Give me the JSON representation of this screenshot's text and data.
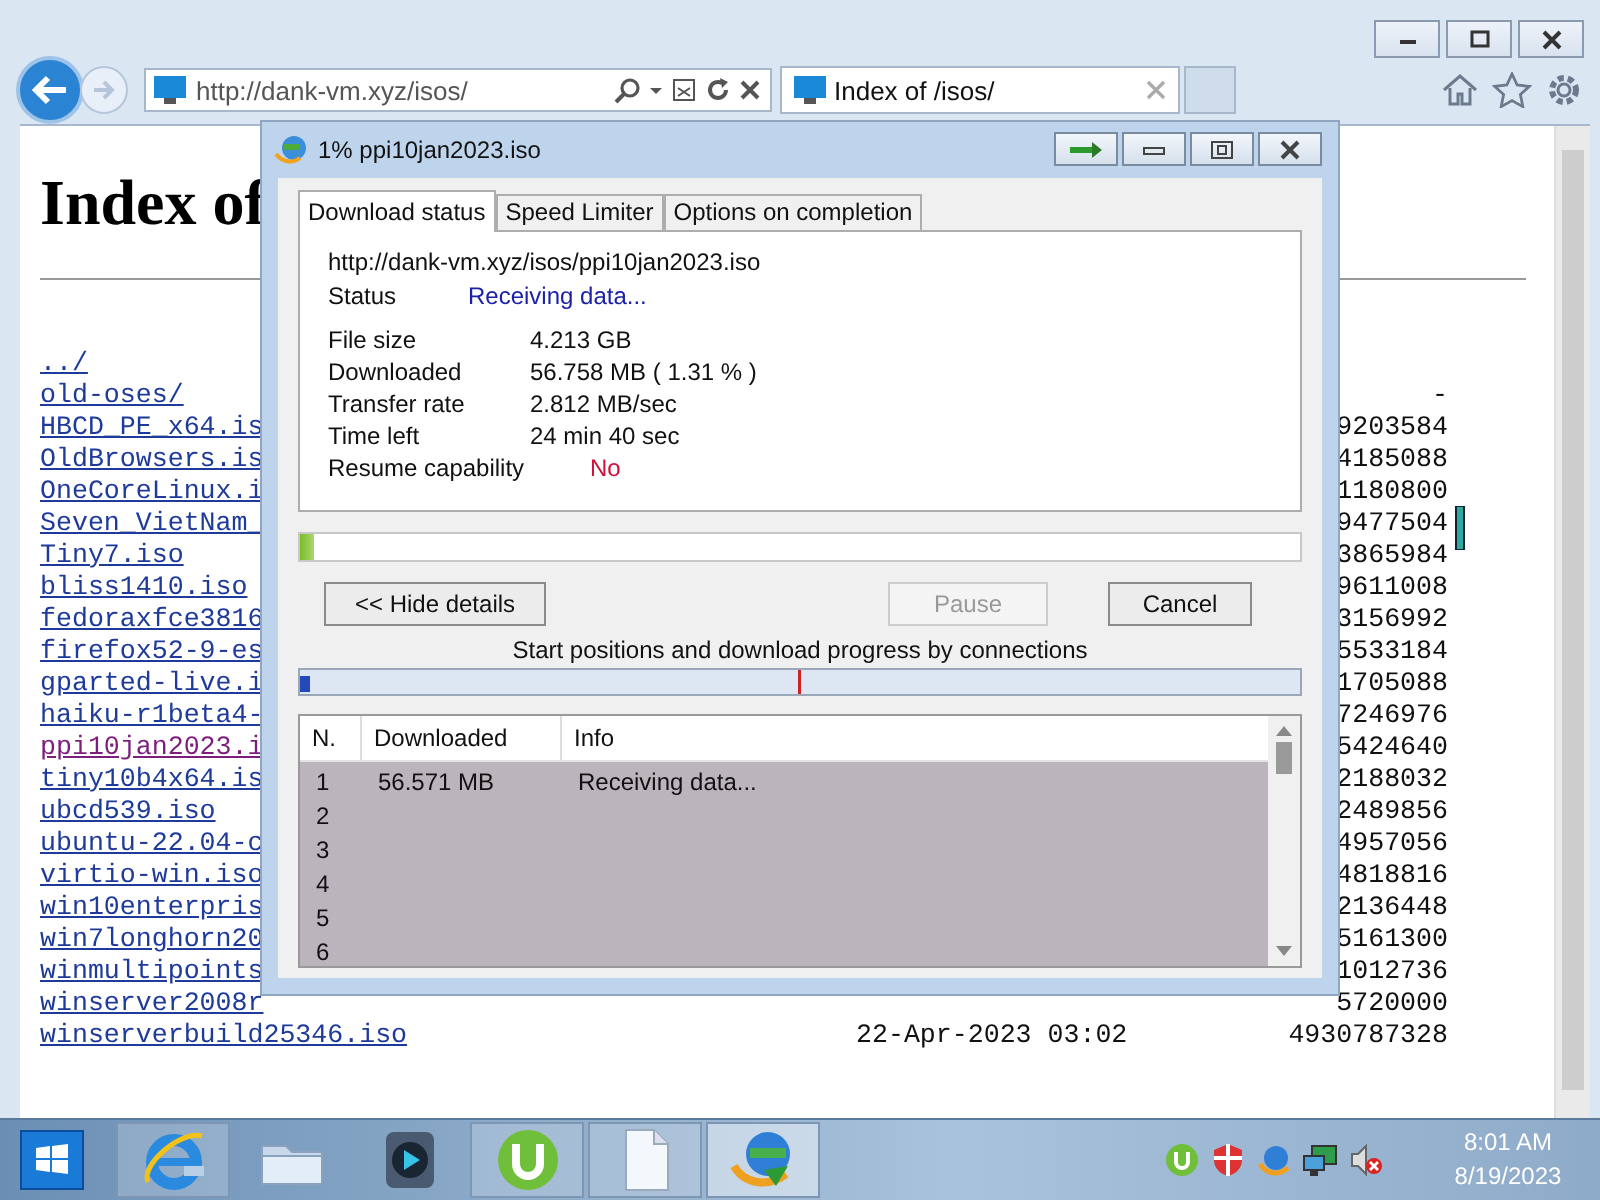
{
  "browser": {
    "address": {
      "value": "http://dank-vm.xyz/isos/"
    },
    "tabs": [
      {
        "label": "Index of /isos/",
        "selected": true
      }
    ]
  },
  "page": {
    "heading": "Index of",
    "listing": [
      {
        "name": "../",
        "visited": false
      },
      {
        "name": "old-oses/",
        "visited": false,
        "size": "-"
      },
      {
        "name": "HBCD_PE_x64.is",
        "visited": false,
        "size": "9203584"
      },
      {
        "name": "OldBrowsers.is",
        "visited": false,
        "size": "4185088"
      },
      {
        "name": "OneCoreLinux.i",
        "visited": false,
        "size": "1180800"
      },
      {
        "name": "Seven_VietNam_",
        "visited": false,
        "size": "9477504"
      },
      {
        "name": "Tiny7.iso",
        "visited": false,
        "size": "3865984"
      },
      {
        "name": "bliss1410.iso",
        "visited": false,
        "size": "9611008"
      },
      {
        "name": "fedoraxfce3816",
        "visited": false,
        "size": "3156992"
      },
      {
        "name": "firefox52-9-es",
        "visited": false,
        "size": "5533184"
      },
      {
        "name": "gparted-live.i",
        "visited": false,
        "size": "1705088"
      },
      {
        "name": "haiku-r1beta4-",
        "visited": false,
        "size": "7246976"
      },
      {
        "name": "ppi10jan2023.i",
        "visited": true,
        "size": "5424640"
      },
      {
        "name": "tiny10b4x64.is",
        "visited": false,
        "size": "2188032"
      },
      {
        "name": "ubcd539.iso",
        "visited": false,
        "size": "2489856"
      },
      {
        "name": "ubuntu-22.04-c",
        "visited": false,
        "size": "4957056"
      },
      {
        "name": "virtio-win.iso",
        "visited": false,
        "size": "4818816"
      },
      {
        "name": "win10enterpris",
        "visited": false,
        "size": "2136448"
      },
      {
        "name": "win7longhorn20",
        "visited": false,
        "size": "5161300"
      },
      {
        "name": "winmultipoints",
        "visited": false,
        "size": "1012736"
      },
      {
        "name": "winserver2008r",
        "visited": false,
        "size": "5720000"
      },
      {
        "name": "winserverbuild25346.iso",
        "visited": false,
        "date": "22-Apr-2023 03:02",
        "size": "4930787328"
      }
    ]
  },
  "dialog": {
    "title": "1% ppi10jan2023.iso",
    "tabs": [
      {
        "label": "Download status",
        "selected": true
      },
      {
        "label": "Speed Limiter",
        "selected": false
      },
      {
        "label": "Options on completion",
        "selected": false
      }
    ],
    "url": "http://dank-vm.xyz/isos/ppi10jan2023.iso",
    "status": {
      "label": "Status",
      "value": "Receiving data..."
    },
    "fields": [
      {
        "label": "File size",
        "value": "4.213  GB",
        "kind": "plain"
      },
      {
        "label": "Downloaded",
        "value": "56.758  MB  ( 1.31 % )",
        "kind": "plain"
      },
      {
        "label": "Transfer rate",
        "value": "2.812  MB/sec",
        "kind": "plain"
      },
      {
        "label": "Time left",
        "value": "24 min 40 sec",
        "kind": "plain"
      },
      {
        "label": "Resume capability",
        "value": "No",
        "kind": "warning"
      }
    ],
    "progress": {
      "level": 0.0131
    },
    "buttons": [
      {
        "label": "<< Hide details",
        "disabled": false
      },
      {
        "label": "Pause",
        "disabled": true
      },
      {
        "label": "Cancel",
        "disabled": false
      }
    ],
    "connections_label": "Start positions and download progress by connections",
    "table": {
      "columns": [
        "N.",
        "Downloaded",
        "Info"
      ],
      "rows": [
        {
          "n": "1",
          "downloaded": "56.571 MB",
          "info": "Receiving data..."
        },
        {
          "n": "2"
        },
        {
          "n": "3"
        },
        {
          "n": "4"
        },
        {
          "n": "5"
        },
        {
          "n": "6"
        }
      ]
    }
  },
  "taskbar": {
    "apps": [
      {
        "kind": "ie",
        "running": true,
        "selected": false
      },
      {
        "kind": "folder",
        "running": false,
        "selected": false
      },
      {
        "kind": "media",
        "running": false,
        "selected": false
      },
      {
        "kind": "torrent",
        "running": true,
        "selected": false
      },
      {
        "kind": "file",
        "running": true,
        "selected": false
      },
      {
        "kind": "idm",
        "running": true,
        "selected": true
      }
    ],
    "clock": {
      "time": "8:01 AM",
      "date": "8/19/2023"
    }
  }
}
